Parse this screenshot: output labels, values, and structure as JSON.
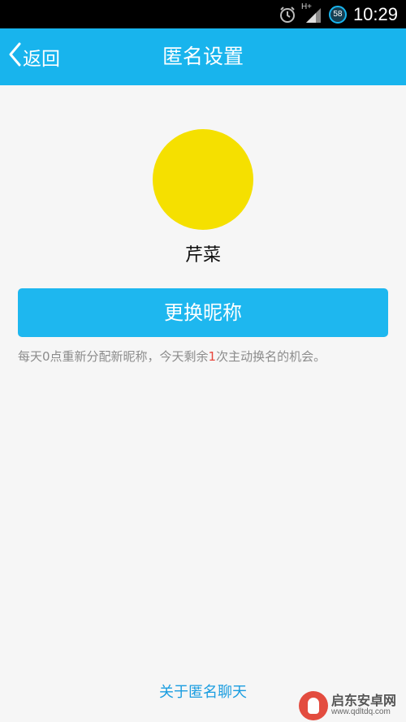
{
  "status_bar": {
    "time": "10:29",
    "network": "H+",
    "battery": "58",
    "icons": [
      "alarm-icon",
      "signal-icon",
      "battery-icon"
    ]
  },
  "header": {
    "back_label": "返回",
    "title": "匿名设置"
  },
  "profile": {
    "avatar_color": "#f5e000",
    "nickname": "芹菜"
  },
  "actions": {
    "change_nickname_label": "更换昵称"
  },
  "hint": {
    "prefix": "每天0点重新分配新昵称，今天剩余",
    "remaining": "1",
    "suffix": "次主动换名的机会。"
  },
  "footer": {
    "about_label": "关于匿名聊天"
  },
  "watermark": {
    "title": "启东安卓网",
    "url": "www.qdltdq.com"
  },
  "colors": {
    "accent": "#18b4ed",
    "button": "#1eb7ef",
    "highlight": "#e8453c",
    "link": "#1a9de0"
  }
}
